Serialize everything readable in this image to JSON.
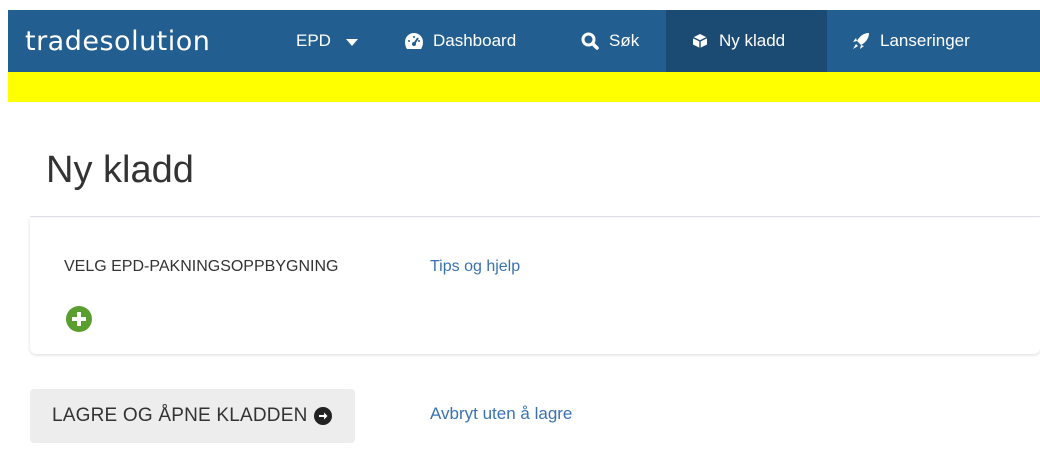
{
  "navbar": {
    "brand": "tradesolution",
    "items": [
      {
        "label": "EPD",
        "icon": "caret-down-icon"
      },
      {
        "label": "Dashboard",
        "icon": "dashboard-icon"
      },
      {
        "label": "Søk",
        "icon": "search-icon"
      },
      {
        "label": "Ny kladd",
        "icon": "box-icon",
        "active": true
      },
      {
        "label": "Lanseringer",
        "icon": "rocket-icon"
      }
    ]
  },
  "page": {
    "title": "Ny kladd"
  },
  "packaging": {
    "section_label": "VELG EPD-PAKNINGSOPPBYGNING",
    "help_link": "Tips og hjelp",
    "add_icon": "plus-circle-icon"
  },
  "actions": {
    "save_label": "LAGRE OG ÅPNE KLADDEN",
    "cancel_label": "Avbryt uten å lagre"
  },
  "colors": {
    "navbar": "#235e91",
    "navbar_active": "#1b4a73",
    "warning_bar": "#ffff00",
    "link": "#3a72b0",
    "add_button": "#5a9e2f",
    "page_background": "#e3e6f0"
  }
}
